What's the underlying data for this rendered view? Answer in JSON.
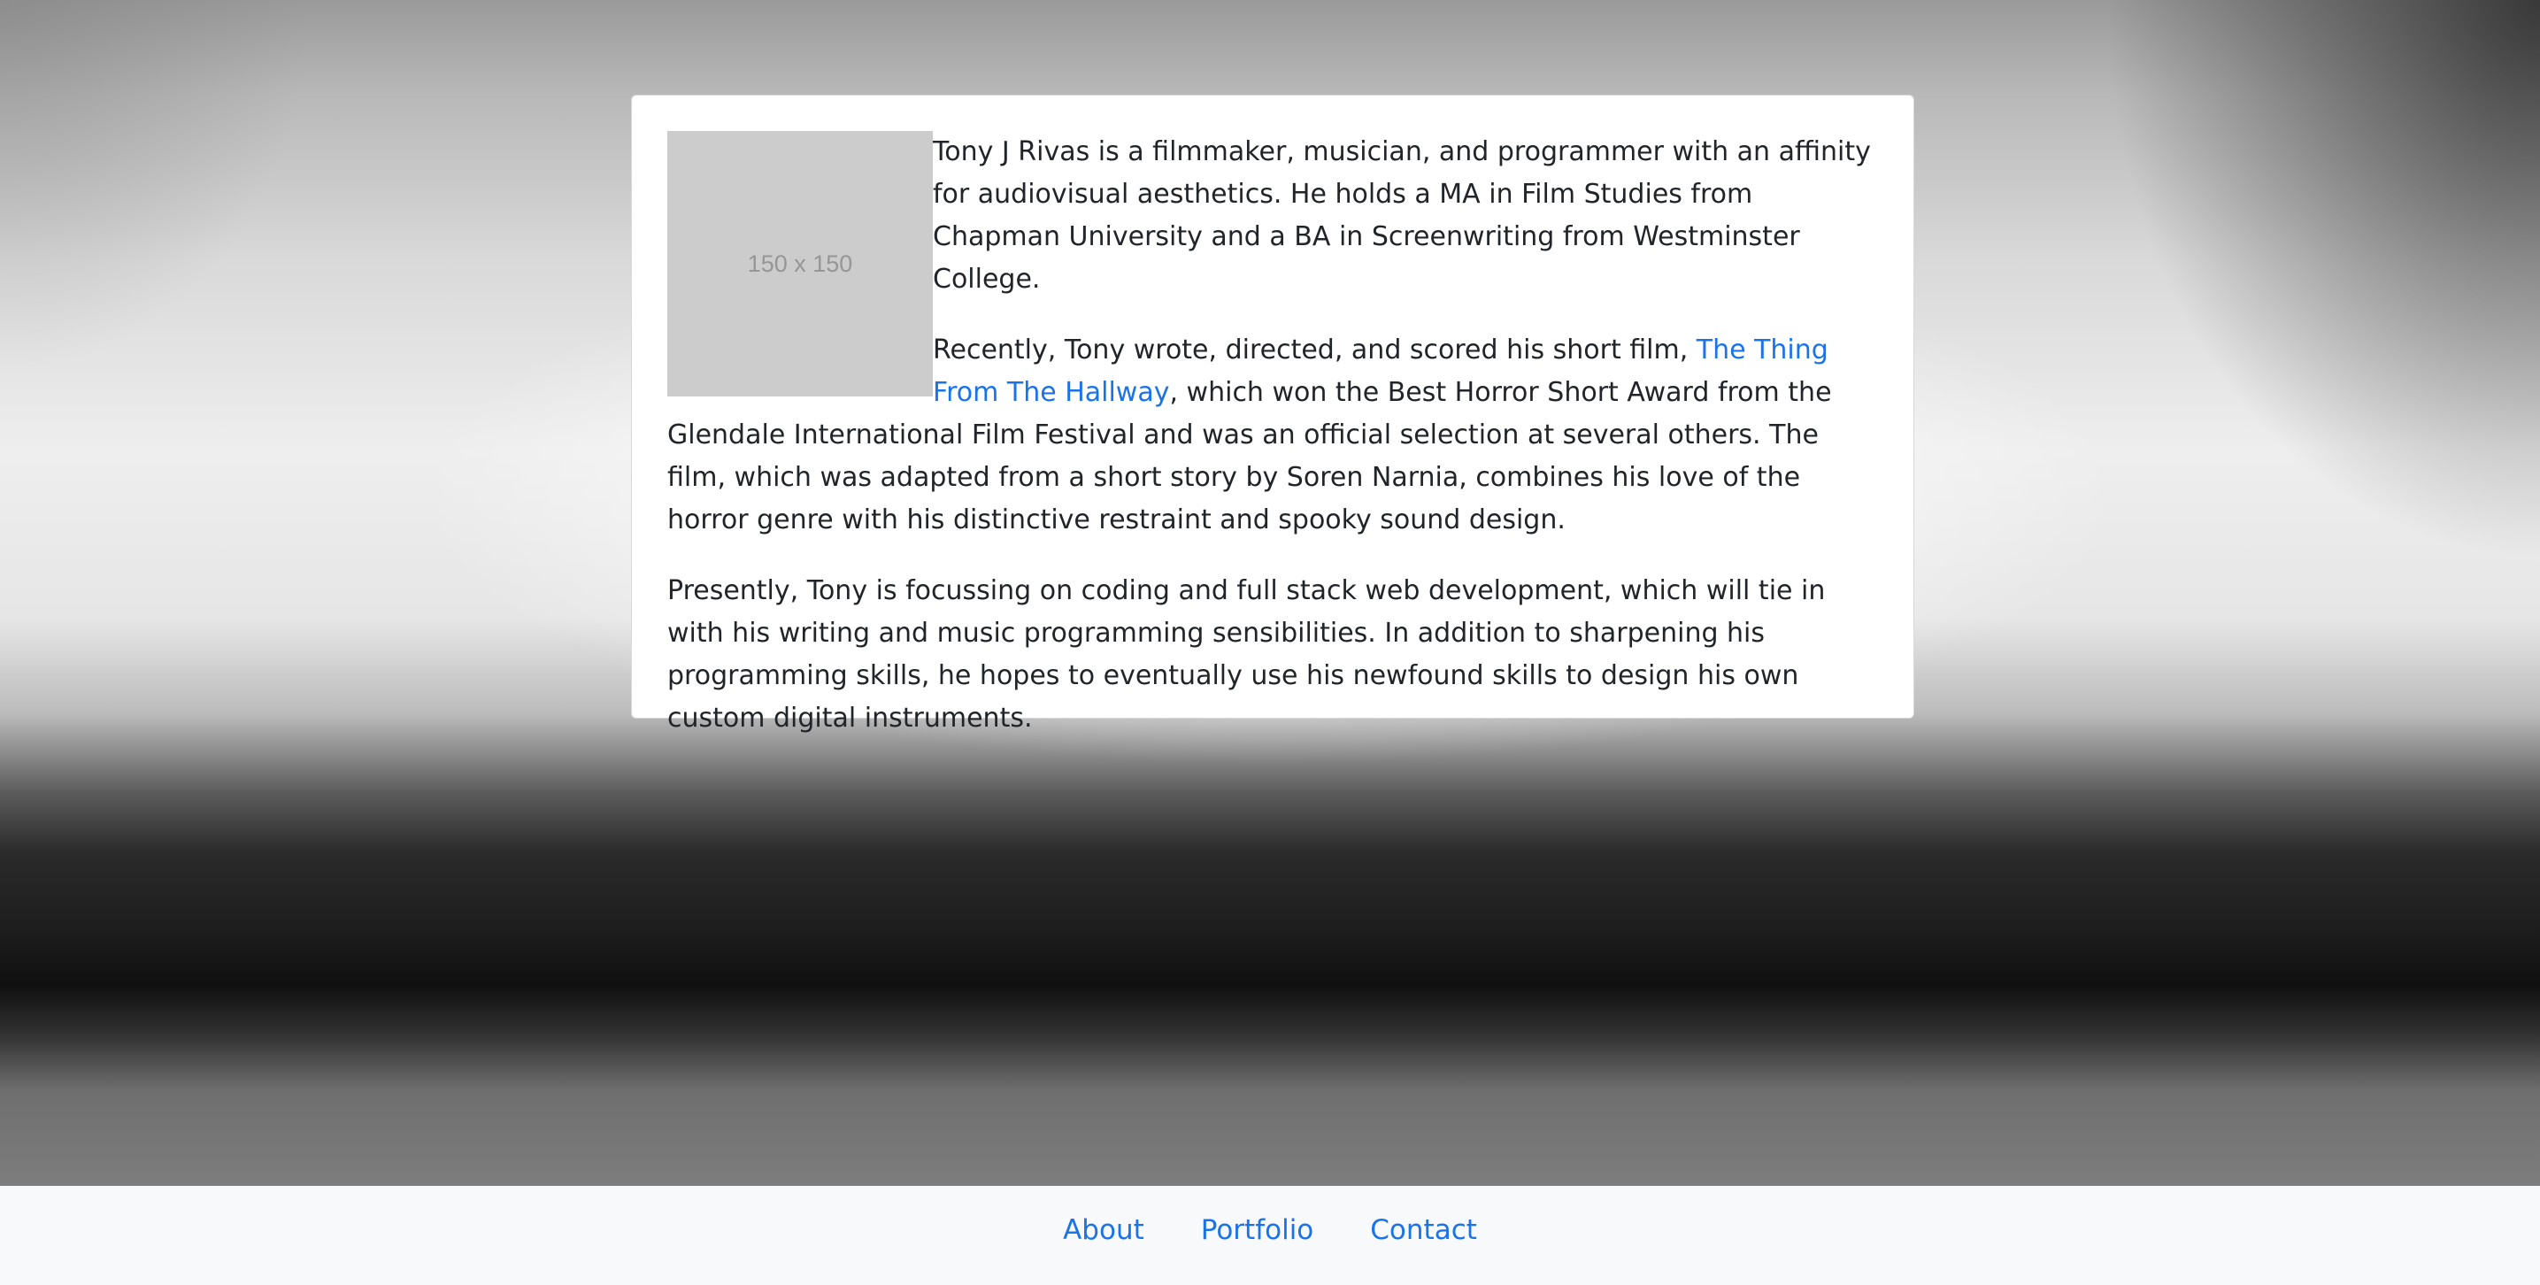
{
  "bio": {
    "image_placeholder": "150 x 150",
    "p1": "Tony J Rivas is a filmmaker, musician, and programmer with an affinity for audiovisual aesthetics. He holds a MA in Film Studies from Chapman University and a BA in Screenwriting from Westminster College.",
    "p2_before": "Recently, Tony wrote, directed, and scored his short film, ",
    "p2_link": "The Thing From The Hallway",
    "p2_after": ", which won the Best Horror Short Award from the Glendale International Film Festival and was an official selection at several others. The film, which was adapted from a short story by Soren Narnia, combines his love of the horror genre with his distinctive restraint and spooky sound design.",
    "p3": "Presently, Tony is focussing on coding and full stack web development, which will tie in with his writing and music programming sensibilities. In addition to sharpening his programming skills, he hopes to eventually use his newfound skills to design his own custom digital instruments."
  },
  "footer": {
    "links": [
      {
        "label": "About"
      },
      {
        "label": "Portfolio"
      },
      {
        "label": "Contact"
      }
    ]
  },
  "colors": {
    "link": "#1a73e8",
    "footer_bg": "#f8f9fa"
  }
}
